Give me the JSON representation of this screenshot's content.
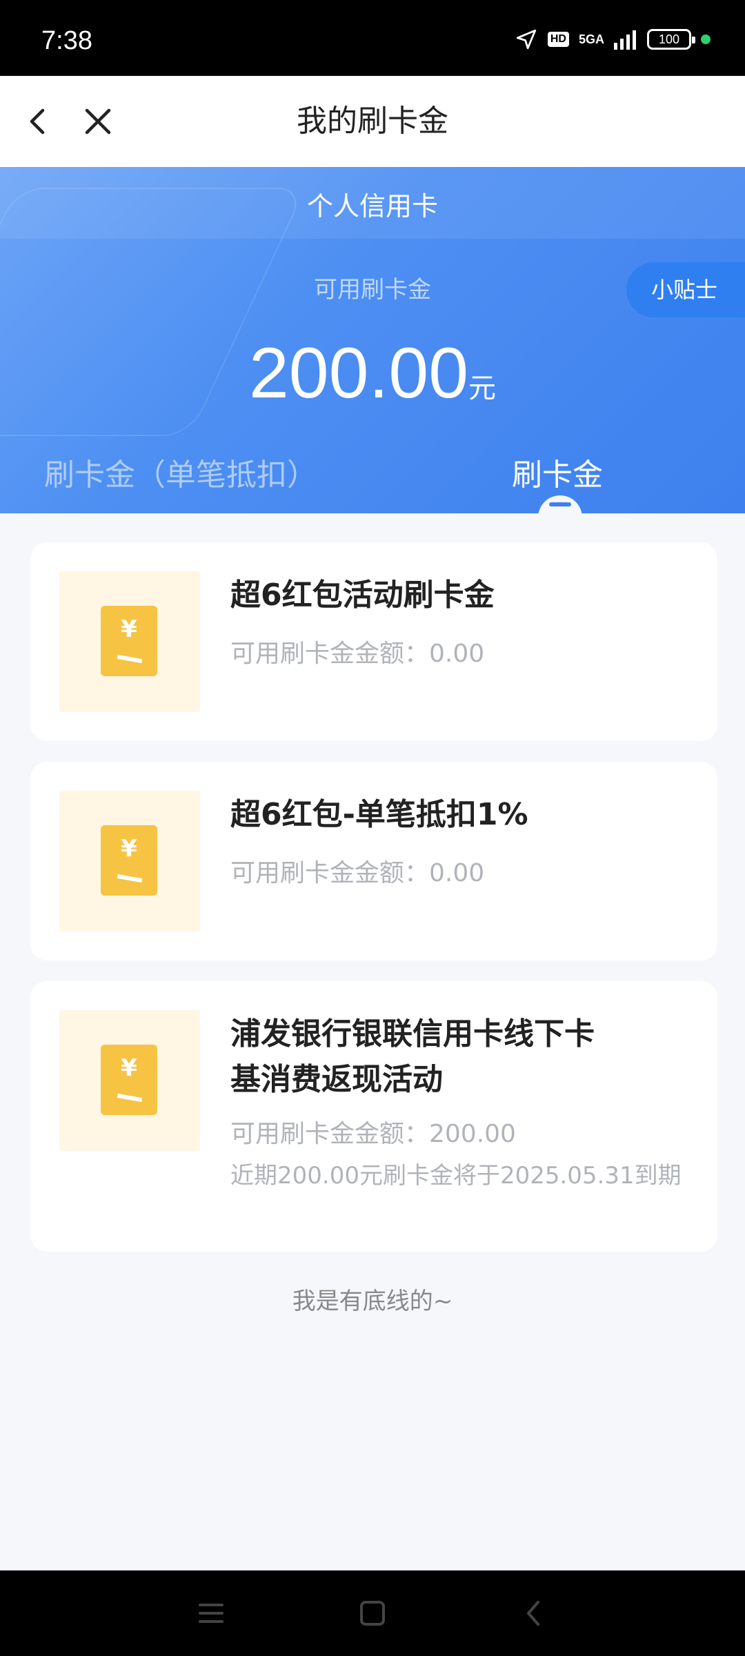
{
  "status_bar": {
    "time": "7:38",
    "hd_badge": "HD",
    "network": "5GA",
    "battery": "100"
  },
  "nav": {
    "title": "我的刷卡金",
    "back_icon": "chevron-left-icon",
    "close_icon": "close-icon"
  },
  "header": {
    "card_type": "个人信用卡",
    "available_label": "可用刷卡金",
    "amount": "200.00",
    "unit": "元",
    "tips_button": "小贴士",
    "tabs": [
      {
        "label": "刷卡金（单笔抵扣）",
        "active": false
      },
      {
        "label": "刷卡金",
        "active": true
      }
    ]
  },
  "items": [
    {
      "title_lines": [
        "超6红包活动刷卡金"
      ],
      "available": "可用刷卡金金额：0.00",
      "note": ""
    },
    {
      "title_lines": [
        "超6红包-单笔抵扣1%"
      ],
      "available": "可用刷卡金金额：0.00",
      "note": ""
    },
    {
      "title_lines": [
        "浦发银行银联信用卡线下卡",
        "基消费返现活动"
      ],
      "available": "可用刷卡金金额：200.00",
      "note": "近期200.00元刷卡金将于2025.05.31到期"
    }
  ],
  "footer": "我是有底线的~",
  "coin_symbol": "¥",
  "colors": {
    "header_blue": "#4d8ff2",
    "tips_blue": "#2f7ff0",
    "coin_yellow": "#f6c343",
    "thumb_bg": "#fff6e4"
  }
}
